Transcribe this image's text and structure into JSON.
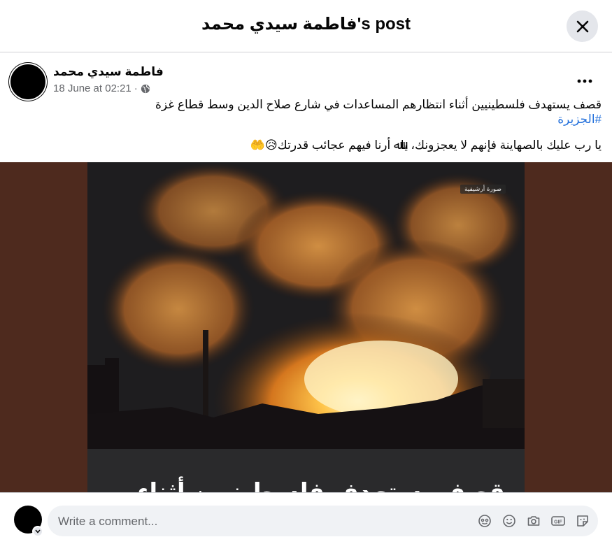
{
  "header": {
    "title": "فاطمة سيدي محمد's post",
    "close_icon": "close-icon"
  },
  "post": {
    "author": "فاطمة سيدي محمد",
    "timestamp": "18 June at 02:21",
    "separator": "·",
    "audience_icon": "globe-icon",
    "more_icon": "more-options-icon",
    "text_line1": "قصف يستهدف فلسطينيين أثناء انتظارهم المساعدات في شارع صلاح الدين وسط قطاع غزة",
    "hashtag": "#الجزيرة",
    "text_line2": "يا رب عليك بالصهاينة فإنهم لا يعجزونك، ياﷲ أرنا فيهم عجائب قدرتك😥🤲"
  },
  "media": {
    "badge": "صورة أرشيفية",
    "caption": "قصف يستهدف فلسطينيين أثناء"
  },
  "comment": {
    "placeholder": "Write a comment...",
    "icons": [
      "avatar-sticker-icon",
      "emoji-icon",
      "camera-icon",
      "gif-icon",
      "sticker-icon"
    ]
  },
  "colors": {
    "link": "#216fdb",
    "media_bg": "#4e2a1e",
    "fire": "#f3a63a"
  }
}
